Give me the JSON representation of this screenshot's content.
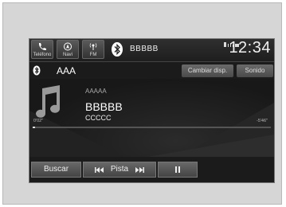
{
  "topbar": {
    "tabs": [
      {
        "label": "Teléfono",
        "icon": "phone-icon"
      },
      {
        "label": "Navi",
        "icon": "navi-icon"
      },
      {
        "label": "FM",
        "icon": "fm-icon"
      }
    ],
    "source_icon": "bluetooth-icon",
    "source_name": "BBBBB",
    "clock": "12:34"
  },
  "subbar": {
    "source_icon": "bluetooth-icon",
    "album": "AAA",
    "change_display_label": "Cambiar disp.",
    "sound_label": "Sonido"
  },
  "now_playing": {
    "artwork_icon": "music-note-icon",
    "artist": "AAAAA",
    "title": "BBBBB",
    "album": "CCCCC",
    "elapsed": "0'02\"",
    "remaining": "-5'46\"",
    "progress": 0.01
  },
  "controls": {
    "search_label": "Buscar",
    "track_label": "Pista",
    "prev_icon": "skip-back-icon",
    "next_icon": "skip-forward-icon",
    "pause_icon": "pause-icon"
  },
  "colors": {
    "screen_bg": "#1b1b1b",
    "button_gray": "#5a5a5a",
    "frame_gray": "#d6d6d6"
  }
}
